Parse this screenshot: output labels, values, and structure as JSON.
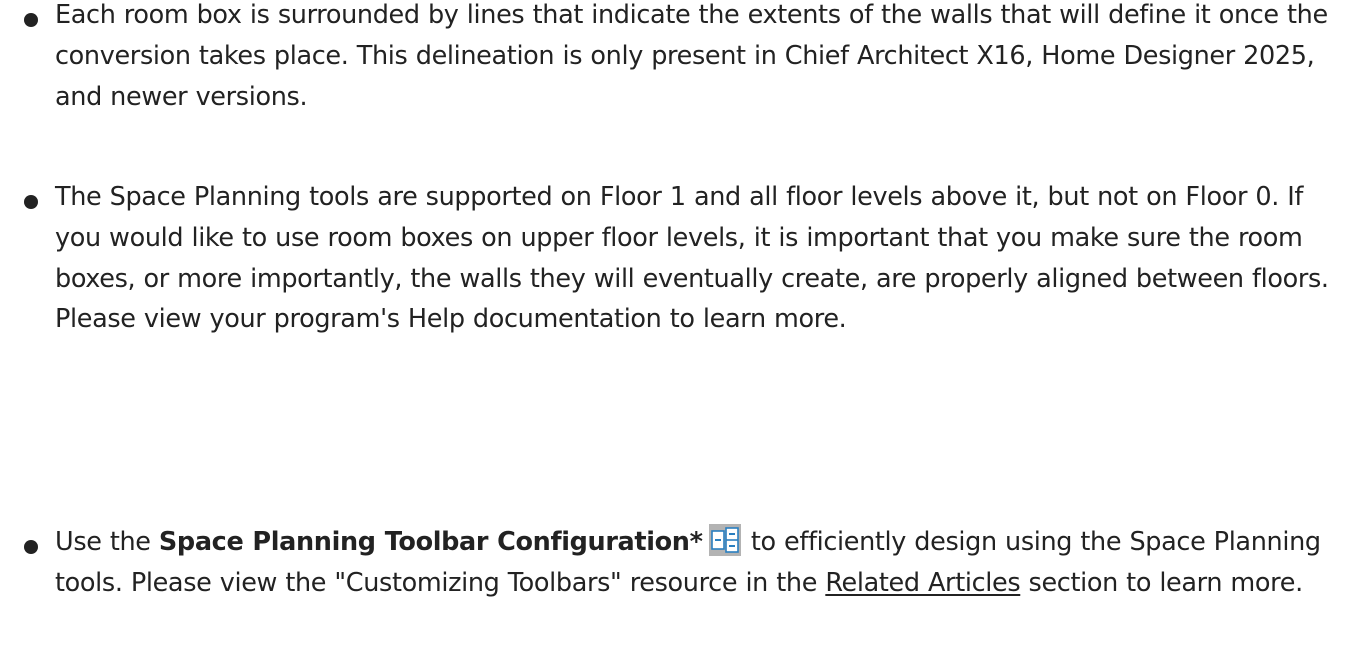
{
  "bullets": [
    {
      "text": "Each room box is surrounded by lines that indicate the extents of the walls that will define it once the conversion takes place. This delineation is only present in Chief Architect X16, Home Designer 2025, and newer versions."
    },
    {
      "text": "The Space Planning tools are supported on Floor 1 and all floor levels above it, but not on Floor 0. If you would like to use room boxes on upper floor levels, it is important that you make sure the room boxes, or more importantly, the walls they will eventually create, are properly aligned between floors. Please view your program's Help documentation to learn more."
    },
    {
      "prefix": "Use the ",
      "bold": "Space Planning Toolbar Configuration*",
      "icon": "space-planning-toolbar-icon",
      "middle": " to efficiently design using the Space Planning tools. Please view the \"Customizing Toolbars\" resource in the ",
      "link": "Related Articles",
      "suffix": " section to learn more."
    }
  ],
  "colors": {
    "text": "#222222",
    "icon_bg": "#b3b3b3",
    "icon_blue": "#2a7fc0"
  }
}
